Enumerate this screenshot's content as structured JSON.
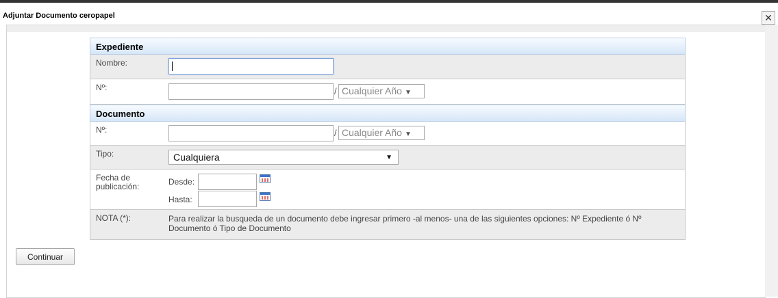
{
  "dialog": {
    "title": "Adjuntar Documento ceropapel",
    "close_label": "✕"
  },
  "expediente": {
    "header": "Expediente",
    "nombre_label": "Nombre:",
    "nombre_value": "",
    "numero_label": "Nº:",
    "numero_value": "",
    "separator": "/",
    "year_select": "Cualquier Año"
  },
  "documento": {
    "header": "Documento",
    "numero_label": "Nº:",
    "numero_value": "",
    "separator": "/",
    "year_select": "Cualquier Año",
    "tipo_label": "Tipo:",
    "tipo_select": "Cualquiera",
    "fecha_label": "Fecha de publicación:",
    "desde_label": "Desde:",
    "hasta_label": "Hasta:",
    "desde_value": "",
    "hasta_value": "",
    "nota_label": "NOTA (*):",
    "nota_text": "Para realizar la busqueda de un documento debe ingresar primero -al menos- una de las siguientes opciones: Nº Expediente ó Nº Documento ó Tipo de Documento"
  },
  "actions": {
    "continuar": "Continuar"
  },
  "icons": {
    "dropdown": "dropdown-arrow-icon",
    "calendar": "calendar-icon",
    "close": "close-icon"
  }
}
